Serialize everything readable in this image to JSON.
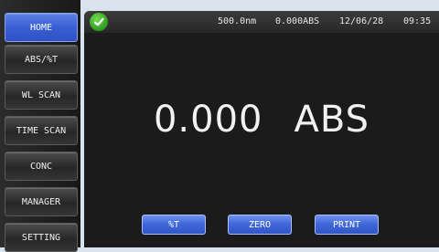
{
  "sidebar": {
    "items": [
      {
        "label": "HOME",
        "active": true
      },
      {
        "label": "ABS/%T",
        "active": false
      },
      {
        "label": "WL SCAN",
        "active": false
      },
      {
        "label": "TIME SCAN",
        "active": false
      },
      {
        "label": "CONC",
        "active": false
      },
      {
        "label": "MANAGER",
        "active": false
      },
      {
        "label": "SETTING",
        "active": false
      }
    ]
  },
  "status": {
    "icon": "check-circle-icon",
    "wavelength": "500.0nm",
    "absorbance": "0.000ABS",
    "date": "12/06/28",
    "time": "09:35"
  },
  "reading": {
    "value": "0.000",
    "unit": "ABS"
  },
  "actions": {
    "percent_t": "%T",
    "zero": "ZERO",
    "print": "PRINT"
  },
  "colors": {
    "active_nav": "#3a5fd4",
    "action_button": "#3f66d8",
    "status_ok": "#2f9a1e",
    "screen_background": "#1b1b1b"
  }
}
